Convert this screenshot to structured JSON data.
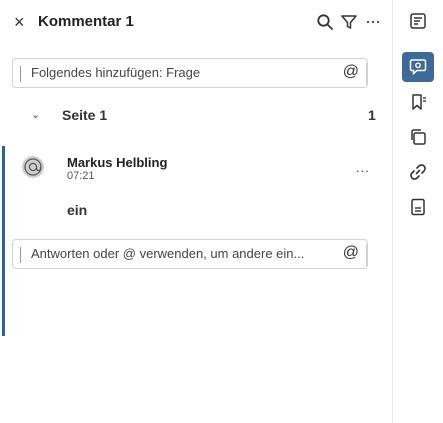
{
  "header": {
    "close_icon": "×",
    "title": "Kommentar 1",
    "icons": [
      "search-icon",
      "filter-icon",
      "more-icon"
    ]
  },
  "add_box": {
    "text": "Folgendes hinzufügen: Frage",
    "at_label": "@"
  },
  "section": {
    "chevron": "⌄",
    "title": "Seite 1",
    "count": "1"
  },
  "comment": {
    "author": "Markus Helbling",
    "time": "07:21",
    "body": "ein",
    "more_label": "..."
  },
  "reply_box": {
    "placeholder": "Antworten oder @ verwenden, um andere ein...",
    "at_label": "@"
  },
  "rail": {
    "icons": [
      "format-icon",
      "comments-icon",
      "bookmark-icon",
      "copy-icon",
      "link-icon",
      "page-icon"
    ],
    "active": "comments-icon"
  },
  "colors": {
    "accent": "#2563a8",
    "rail_active": "#3d6a96",
    "avatar_bg": "#cfcfcf"
  }
}
